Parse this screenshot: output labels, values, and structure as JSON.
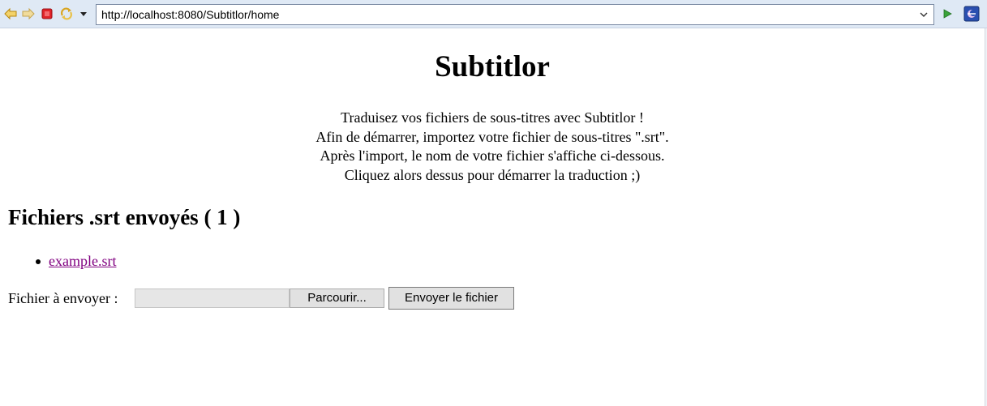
{
  "browser": {
    "url": "http://localhost:8080/Subtitlor/home",
    "icons": {
      "back": "back-arrow-icon",
      "forward": "forward-arrow-icon",
      "stop": "stop-icon",
      "refresh": "refresh-icon",
      "menu": "chevron-down-icon",
      "address_dropdown": "chevron-down-icon",
      "go": "go-play-icon",
      "extra": "eclipse-browser-icon"
    },
    "colors": {
      "toolbar_bg": "#dfe9f5",
      "back_forward": "#f0c040",
      "stop": "#e0242a",
      "go": "#3aa33a",
      "extra": "#2a4fb0"
    }
  },
  "page": {
    "title": "Subtitlor",
    "intro_lines": [
      "Traduisez vos fichiers de sous-titres avec Subtitlor !",
      "Afin de démarrer, importez votre fichier de sous-titres \".srt\".",
      "Après l'import, le nom de votre fichier s'affiche ci-dessous.",
      "Cliquez alors dessus pour démarrer la traduction ;)"
    ],
    "files_heading": "Fichiers .srt envoyés ( 1 )",
    "files": [
      {
        "name": "example.srt"
      }
    ],
    "link_color": "#800080",
    "upload": {
      "label": "Fichier à envoyer :",
      "file_value": "",
      "browse_label": "Parcourir...",
      "submit_label": "Envoyer le fichier"
    }
  }
}
